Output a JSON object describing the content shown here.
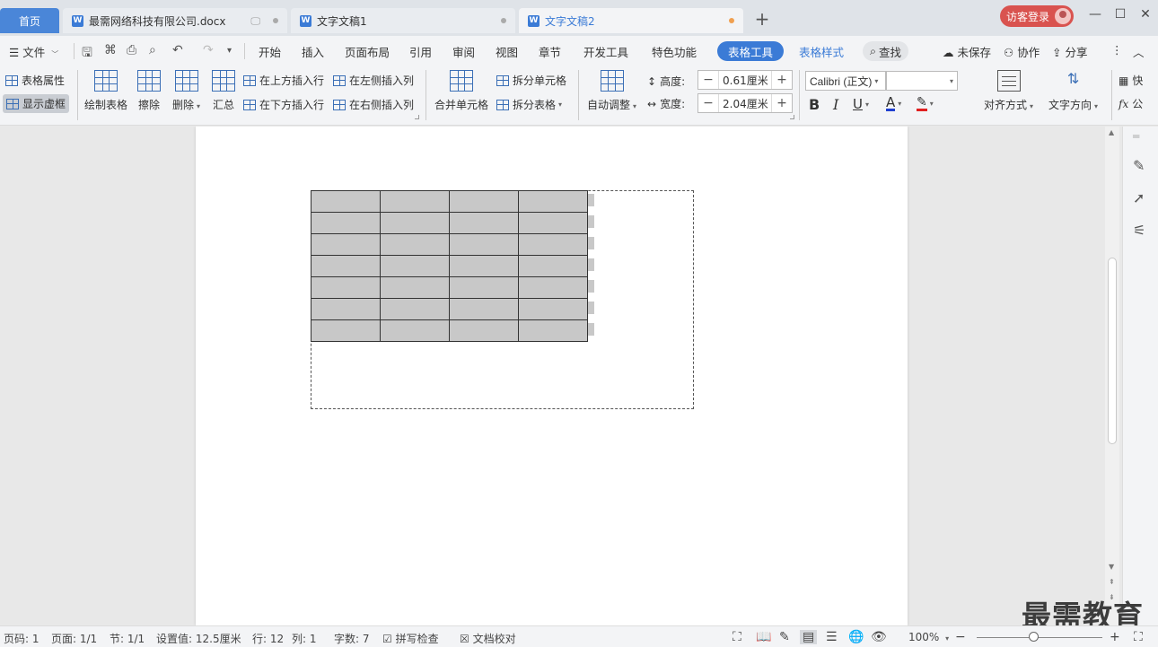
{
  "tabs": {
    "home": "首页",
    "doc1": "最需网络科技有限公司.docx",
    "doc2": "文字文稿1",
    "doc3": "文字文稿2",
    "new_tab": "+",
    "login": "访客登录"
  },
  "menu": {
    "file": "文件",
    "start": "开始",
    "insert": "插入",
    "layout": "页面布局",
    "ref": "引用",
    "review": "审阅",
    "view": "视图",
    "section": "章节",
    "dev": "开发工具",
    "special": "特色功能",
    "table_tools": "表格工具",
    "table_style": "表格样式",
    "search": "查找",
    "unsaved": "未保存",
    "collab": "协作",
    "share": "分享"
  },
  "ribbon": {
    "table_props": "表格属性",
    "show_grid": "显示虚框",
    "draw_table": "绘制表格",
    "erase": "擦除",
    "delete": "删除",
    "summary": "汇总",
    "insert_above": "在上方插入行",
    "insert_below": "在下方插入行",
    "insert_left": "在左侧插入列",
    "insert_right": "在右侧插入列",
    "merge_cells": "合并单元格",
    "split_cells": "拆分单元格",
    "split_table": "拆分表格",
    "auto_fit": "自动调整",
    "height_label": "高度:",
    "height_value": "0.61厘米",
    "width_label": "宽度:",
    "width_value": "2.04厘米",
    "font_name": "Calibri (正文)",
    "bold": "B",
    "italic": "I",
    "underline": "U",
    "font_color": "A",
    "align": "对齐方式",
    "text_dir": "文字方向",
    "quick": "快",
    "formula": "公",
    "fx": "fx"
  },
  "table": {
    "rows": 7,
    "cols": 4
  },
  "status": {
    "page_code": "页码: 1",
    "page": "页面: 1/1",
    "section": "节: 1/1",
    "setting": "设置值: 12.5厘米",
    "row": "行: 12",
    "col": "列: 1",
    "words": "字数: 7",
    "spell": "拼写检查",
    "proof": "文档校对",
    "zoom": "100%",
    "zoom_level": 0.45
  },
  "watermark": "最需教育",
  "colors": {
    "accent": "#3b7bd6",
    "home_tab": "#4a86d8",
    "login": "#d9534f",
    "table_fill": "#c8c8c8",
    "font_color_bar": "#1f3fd0",
    "highlight_bar": "#e02020"
  }
}
